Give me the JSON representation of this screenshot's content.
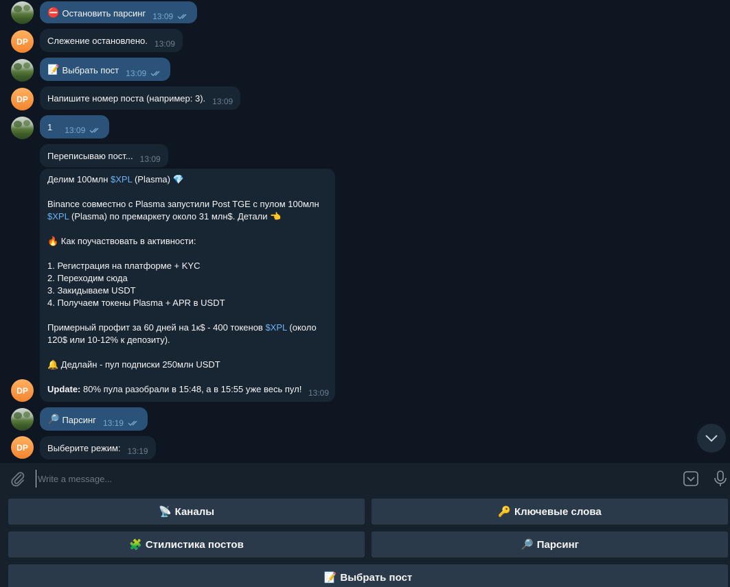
{
  "messages": [
    {
      "emoji": "⛔",
      "text": "Остановить парсинг",
      "time": "13:09"
    },
    {
      "sender_initials": "DP",
      "text": "Слежение остановлено.",
      "time": "13:09"
    },
    {
      "emoji": "📝",
      "text": "Выбрать пост",
      "time": "13:09"
    },
    {
      "sender_initials": "DP",
      "text": "Напишите номер поста (например: 3).",
      "time": "13:09"
    },
    {
      "text": "1",
      "time": "13:09"
    },
    {
      "text": "Переписываю пост...",
      "time": "13:09"
    },
    {
      "sender_initials": "DP",
      "time": "13:09",
      "line1_a": "Делим 100млн ",
      "line1_link": "$XPL",
      "line1_b": " (Plasma) ",
      "line1_emoji": "💎",
      "line2": "Binance совместно с Plasma запустили Post TGE с пулом 100млн",
      "line3_link": "$XPL",
      "line3_b": " (Plasma) по премаркету около 31 млн$. Детали ",
      "line3_emoji": "👈",
      "line4_emoji": "🔥",
      "line4": " Как поучаствовать в активности:",
      "step1": "1. Регистрация на платформе + KYC",
      "step2": "2. Переходим сюда",
      "step3": "3. Закидываем USDT",
      "step4": "4. Получаем токены Plasma + APR в USDT",
      "profit_a": "Примерный профит за 60 дней на 1к$ - 400 токенов ",
      "profit_link": "$XPL",
      "profit_b": " (около",
      "profit_c": "120$ или 10-12% к депозиту).",
      "deadline_emoji": "🔔",
      "deadline": " Дедлайн - пул подписки 250млн USDT",
      "update_label": "Update:",
      "update_text": " 80% пула разобрали в 15:48, а в 15:55 уже весь пул!"
    },
    {
      "emoji": "🔎",
      "text": "Парсинг",
      "time": "13:19"
    },
    {
      "sender_initials": "DP",
      "text": "Выберите режим:",
      "time": "13:19"
    }
  ],
  "composer": {
    "placeholder": "Write a message..."
  },
  "keyboard": {
    "channels": {
      "emoji": "📡",
      "label": "Каналы"
    },
    "keywords": {
      "emoji": "🔑",
      "label": "Ключевые слова"
    },
    "style": {
      "emoji": "🧩",
      "label": "Стилистика постов"
    },
    "parsing": {
      "emoji": "🔎",
      "label": "Парсинг"
    },
    "choose_post": {
      "emoji": "📝",
      "label": "Выбрать пост"
    }
  },
  "icons": {
    "attach": "paperclip-icon",
    "commands": "bot-commands-icon",
    "mic": "microphone-icon",
    "read": "double-check-icon",
    "scroll": "chevron-down-icon"
  },
  "colors": {
    "chat_bg": "#0e1621",
    "outgoing_bubble": "#2b5278",
    "incoming_bubble": "#182533",
    "link": "#6ab3f3",
    "keyboard_button": "#2a3a4a"
  }
}
